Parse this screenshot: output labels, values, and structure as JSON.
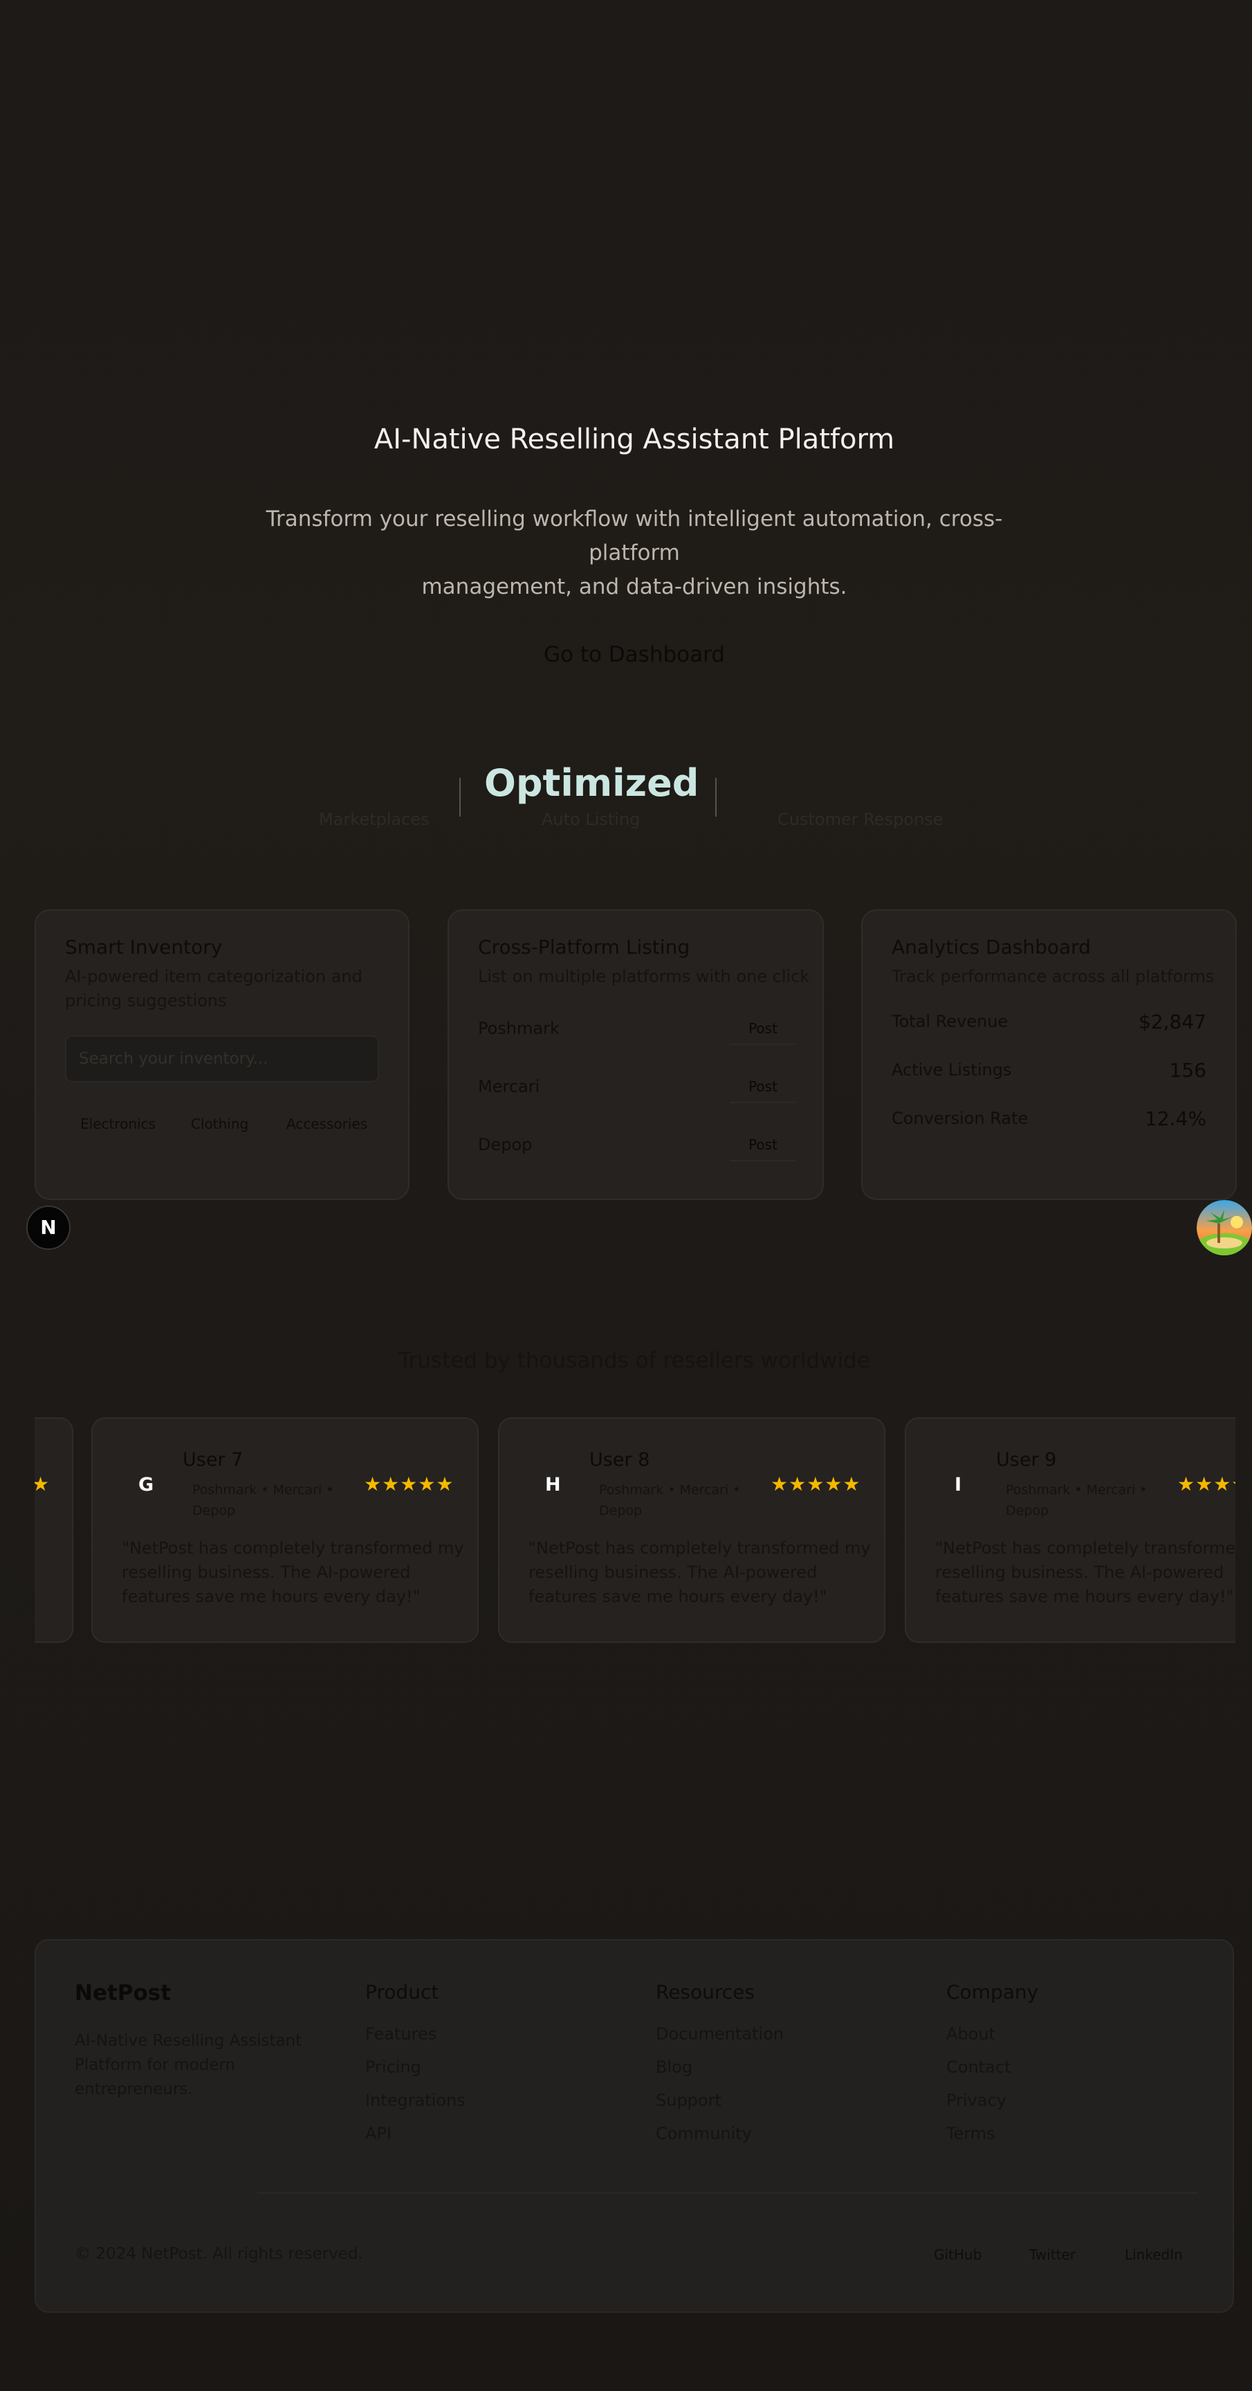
{
  "hero": {
    "title": "AI-Native Reselling Assistant Platform",
    "subtitle_line1": "Transform your reselling workflow with intelligent automation, cross-platform",
    "subtitle_line2": "management, and data-driven insights.",
    "cta_label": "Go to Dashboard"
  },
  "stats": {
    "highlight": "Optimized",
    "labels": [
      "Marketplaces",
      "Auto Listing",
      "Customer Response"
    ]
  },
  "features": {
    "inventory": {
      "title": "Smart Inventory",
      "desc_line1": "AI-powered item categorization and",
      "desc_line2": "pricing suggestions",
      "search_placeholder": "Search your inventory...",
      "tags": [
        "Electronics",
        "Clothing",
        "Accessories"
      ]
    },
    "listing": {
      "title": "Cross-Platform Listing",
      "desc": "List on multiple platforms with one click",
      "platforms": [
        "Poshmark",
        "Mercari",
        "Depop"
      ],
      "post_label": "Post"
    },
    "analytics": {
      "title": "Analytics Dashboard",
      "desc": "Track performance across all platforms",
      "metrics": [
        {
          "label": "Total Revenue",
          "value": "$2,847"
        },
        {
          "label": "Active Listings",
          "value": "156"
        },
        {
          "label": "Conversion Rate",
          "value": "12.4%"
        }
      ]
    }
  },
  "badge": {
    "letter": "N"
  },
  "testimonials": {
    "heading": "Trusted by thousands of resellers worldwide",
    "items": [
      {
        "initial": "G",
        "name": "User 7",
        "platforms_line1": "Poshmark • Mercari •",
        "platforms_line2": "Depop",
        "stars": "★★★★★",
        "quote_line1": "\"NetPost has completely transformed my",
        "quote_line2": "reselling business. The AI-powered",
        "quote_line3": "features save me hours every day!\""
      },
      {
        "initial": "H",
        "name": "User 8",
        "platforms_line1": "Poshmark • Mercari •",
        "platforms_line2": "Depop",
        "stars": "★★★★★",
        "quote_line1": "\"NetPost has completely transformed my",
        "quote_line2": "reselling business. The AI-powered",
        "quote_line3": "features save me hours every day!\""
      },
      {
        "initial": "I",
        "name": "User 9",
        "platforms_line1": "Poshmark • Mercari •",
        "platforms_line2": "Depop",
        "stars": "★★★★★",
        "quote_line1": "\"NetPost has completely transformed my",
        "quote_line2": "reselling business. The AI-powered",
        "quote_line3": "features save me hours every day!\""
      }
    ],
    "partial_star": "★"
  },
  "footer": {
    "brand": "NetPost",
    "desc_line1": "AI-Native Reselling Assistant",
    "desc_line2": "Platform for modern",
    "desc_line3": "entrepreneurs.",
    "columns": [
      {
        "heading": "Product",
        "links": [
          "Features",
          "Pricing",
          "Integrations",
          "API"
        ]
      },
      {
        "heading": "Resources",
        "links": [
          "Documentation",
          "Blog",
          "Support",
          "Community"
        ]
      },
      {
        "heading": "Company",
        "links": [
          "About",
          "Contact",
          "Privacy",
          "Terms"
        ]
      }
    ],
    "copyright": "© 2024 NetPost. All rights reserved.",
    "social": [
      "GitHub",
      "Twitter",
      "LinkedIn"
    ]
  }
}
